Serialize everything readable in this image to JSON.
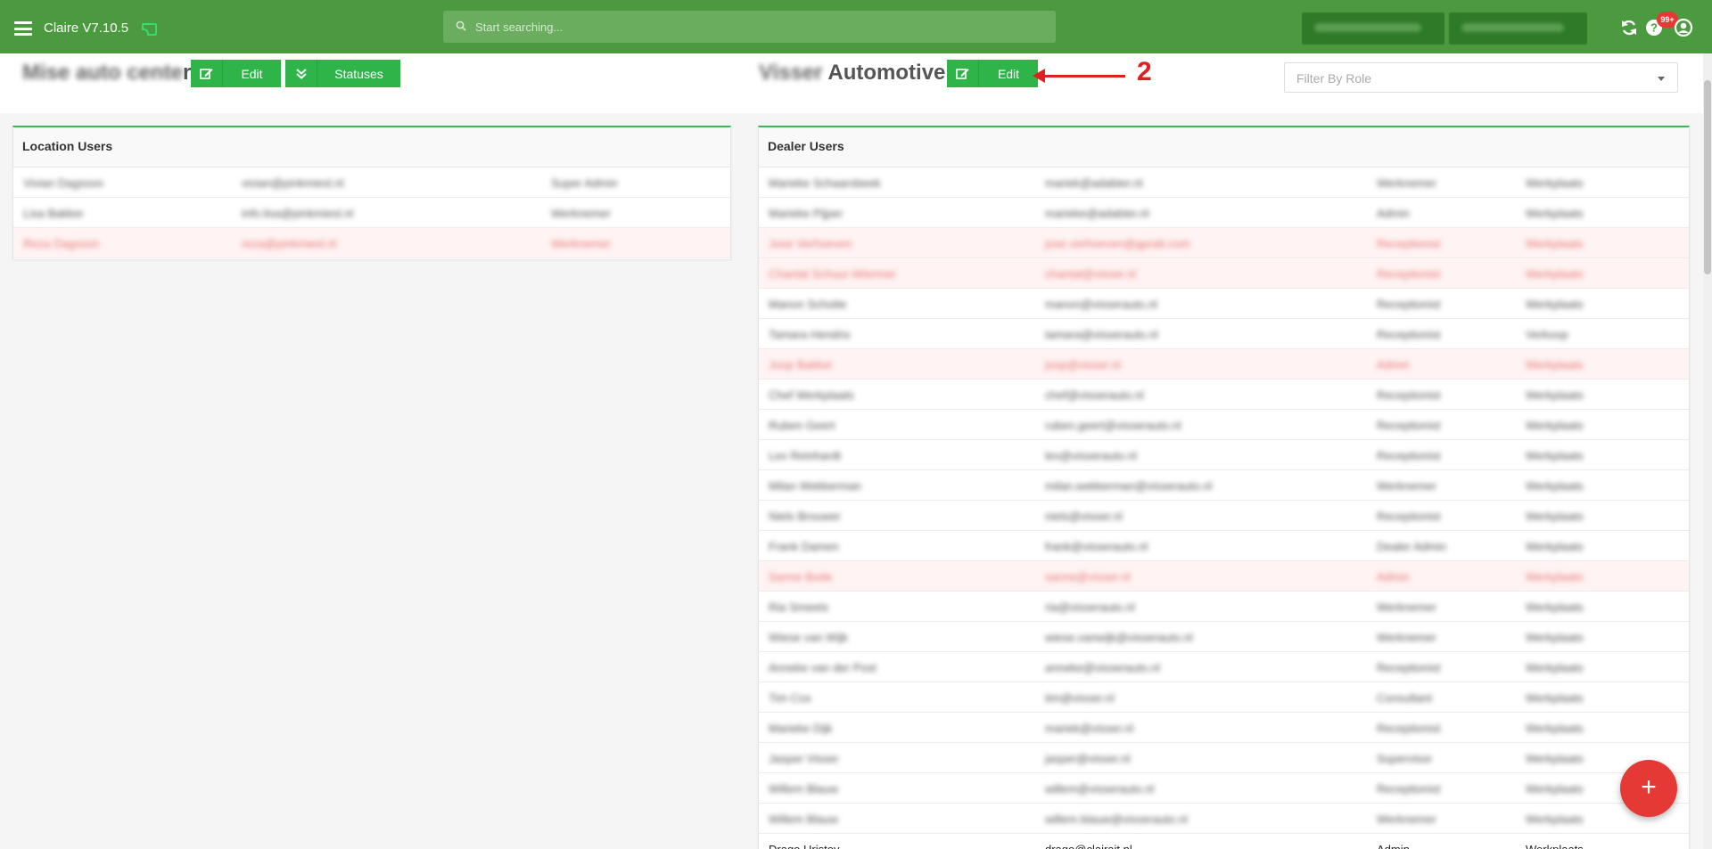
{
  "app": {
    "title": "Claire V7.10.5"
  },
  "search": {
    "placeholder": "Start searching..."
  },
  "notifications": {
    "badge": "99+"
  },
  "location": {
    "name_blurred": "Mise auto cente",
    "name_tail": "r",
    "edit_label": "Edit",
    "statuses_label": "Statuses"
  },
  "dealer": {
    "name_blurred": "Visser",
    "name_visible": "Automotive",
    "edit_label": "Edit"
  },
  "annotation": {
    "step": "2"
  },
  "filter": {
    "placeholder": "Filter By Role"
  },
  "location_users": {
    "title": "Location Users",
    "rows": [
      {
        "name": "Vivian Dagsson",
        "email": "vivian@pinkmiesl.nl",
        "role": "Super Admin",
        "inactive": false
      },
      {
        "name": "Lisa Bakker",
        "email": "info.lisa@pinkmiesl.nl",
        "role": "Werknemer",
        "inactive": false
      },
      {
        "name": "Reza Dagsson",
        "email": "reza@pinkmiesl.nl",
        "role": "Werknemer",
        "inactive": true
      }
    ]
  },
  "dealer_users": {
    "title": "Dealer Users",
    "rows": [
      {
        "name": "Marieke Schaarsbeek",
        "email": "mariek@adabter.nl",
        "role": "Werknemer",
        "loc": "Werkplaats",
        "inactive": false,
        "clear": false
      },
      {
        "name": "Marieke Pijper",
        "email": "marieke@adabter.nl",
        "role": "Admin",
        "loc": "Werkplaats",
        "inactive": false,
        "clear": false
      },
      {
        "name": "Jose Verhoeven",
        "email": "jose.verhoeven@gpratt.com",
        "role": "Receptionist",
        "loc": "Werkplaats",
        "inactive": true,
        "clear": false
      },
      {
        "name": "Chantal Schuur-Wiermer",
        "email": "chantal@visser.nl",
        "role": "Receptionist",
        "loc": "Werkplaats",
        "inactive": true,
        "clear": false
      },
      {
        "name": "Manon Schotte",
        "email": "manon@visserauto.nl",
        "role": "Receptionist",
        "loc": "Werkplaats",
        "inactive": false,
        "clear": false
      },
      {
        "name": "Tamara Hendrix",
        "email": "tamara@visserauto.nl",
        "role": "Receptionist",
        "loc": "Verkoop",
        "inactive": false,
        "clear": false
      },
      {
        "name": "Joop Bakker",
        "email": "joop@visser.nl",
        "role": "Admin",
        "loc": "Werkplaats",
        "inactive": true,
        "clear": false
      },
      {
        "name": "Chef Werkplaats",
        "email": "chef@visserauto.nl",
        "role": "Receptionist",
        "loc": "Werkplaats",
        "inactive": false,
        "clear": false
      },
      {
        "name": "Ruben Geert",
        "email": "ruben.geert@visserauto.nl",
        "role": "Receptionist",
        "loc": "Werkplaats",
        "inactive": false,
        "clear": false
      },
      {
        "name": "Lex Reinhardt",
        "email": "lex@visserauto.nl",
        "role": "Receptionist",
        "loc": "Werkplaats",
        "inactive": false,
        "clear": false
      },
      {
        "name": "Milan Wekkerman",
        "email": "milan.wekkerman@visserauto.nl",
        "role": "Werknemer",
        "loc": "Werkplaats",
        "inactive": false,
        "clear": false
      },
      {
        "name": "Niels Brouwer",
        "email": "niels@visser.nl",
        "role": "Receptionist",
        "loc": "Werkplaats",
        "inactive": false,
        "clear": false
      },
      {
        "name": "Frank Damen",
        "email": "frank@visserauto.nl",
        "role": "Dealer Admin",
        "loc": "Werkplaats",
        "inactive": false,
        "clear": false
      },
      {
        "name": "Sanne Bode",
        "email": "sanne@visser.nl",
        "role": "Admin",
        "loc": "Werkplaats",
        "inactive": true,
        "clear": false
      },
      {
        "name": "Ria Smeets",
        "email": "ria@visserauto.nl",
        "role": "Werknemer",
        "loc": "Werkplaats",
        "inactive": false,
        "clear": false
      },
      {
        "name": "Wiese van Wijk",
        "email": "wiese.vanwijk@visserauto.nl",
        "role": "Werknemer",
        "loc": "Werkplaats",
        "inactive": false,
        "clear": false
      },
      {
        "name": "Anneke van der Post",
        "email": "anneke@visserauto.nl",
        "role": "Receptionist",
        "loc": "Werkplaats",
        "inactive": false,
        "clear": false
      },
      {
        "name": "Tim Cox",
        "email": "tim@visser.nl",
        "role": "Consultant",
        "loc": "Werkplaats",
        "inactive": false,
        "clear": false
      },
      {
        "name": "Marieke Dijk",
        "email": "mariek@visser.nl",
        "role": "Receptionist",
        "loc": "Werkplaats",
        "inactive": false,
        "clear": false
      },
      {
        "name": "Jasper Visser",
        "email": "jasper@visser.nl",
        "role": "Supervisor",
        "loc": "Werkplaats",
        "inactive": false,
        "clear": false
      },
      {
        "name": "Willem Blauw",
        "email": "willem@visserauto.nl",
        "role": "Receptionist",
        "loc": "Werkplaats",
        "inactive": false,
        "clear": false
      },
      {
        "name": "Willem Blauw",
        "email": "willem.blauw@visserauto.nl",
        "role": "Werknemer",
        "loc": "Werkplaats",
        "inactive": false,
        "clear": false
      },
      {
        "name": "Drago Hristov",
        "email": "drago@clairait.nl",
        "role": "Admin",
        "loc": "Werkplaats",
        "inactive": false,
        "clear": true
      }
    ]
  },
  "colors": {
    "topbar": "#4c9a3f",
    "accent": "#2fb44a",
    "danger": "#e53935"
  }
}
